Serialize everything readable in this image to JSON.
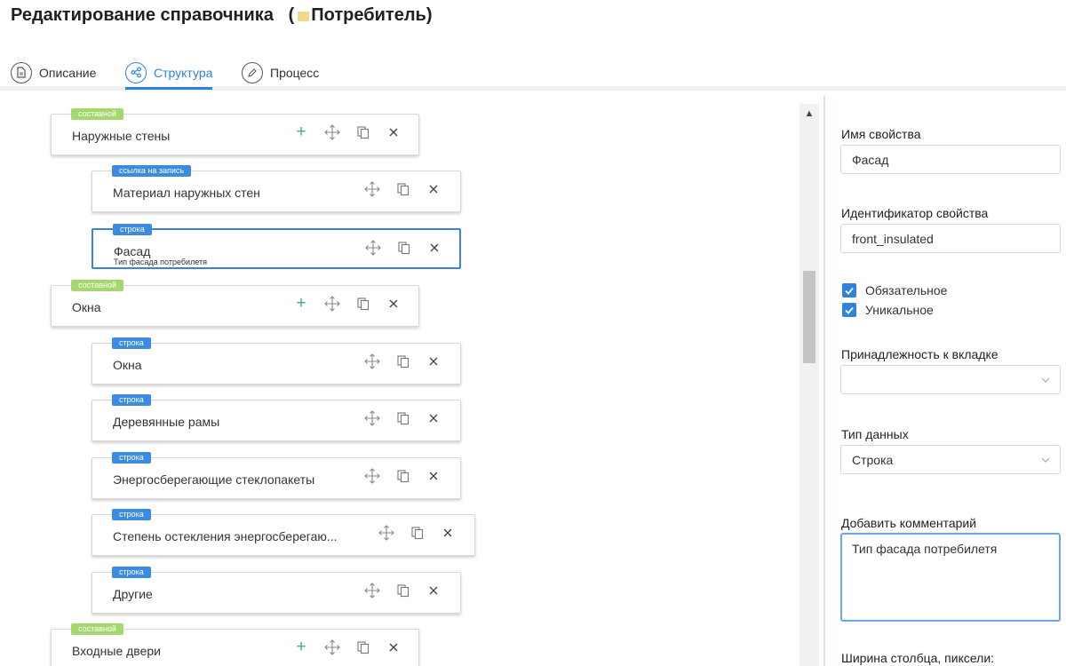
{
  "header": {
    "title_prefix": "Редактирование справочника",
    "title_paren_open": "(",
    "title_name": "Потребитель",
    "title_paren_close": ")"
  },
  "tabs": [
    {
      "label": "Описание",
      "icon": "document-icon",
      "active": false
    },
    {
      "label": "Структура",
      "icon": "share-icon",
      "active": true
    },
    {
      "label": "Процесс",
      "icon": "pencil-icon",
      "active": false
    }
  ],
  "tree": {
    "items": [
      {
        "tag": "составной",
        "tag_color": "#a5d86c",
        "title": "Наружные стены",
        "level": 0
      },
      {
        "tag": "ссылка на запись",
        "tag_color": "#3b8be0",
        "title": "Материал наружных стен",
        "level": 1
      },
      {
        "tag": "строка",
        "tag_color": "#3b8be0",
        "title": "Фасад",
        "subtitle": "Тип фасада потребилетя",
        "level": 1,
        "selected": true
      },
      {
        "tag": "составной",
        "tag_color": "#a5d86c",
        "title": "Окна",
        "level": 0
      },
      {
        "tag": "строка",
        "tag_color": "#3b8be0",
        "title": "Окна",
        "level": 1
      },
      {
        "tag": "строка",
        "tag_color": "#3b8be0",
        "title": "Деревянные рамы",
        "level": 1
      },
      {
        "tag": "строка",
        "tag_color": "#3b8be0",
        "title": "Энергосберегающие стеклопакеты",
        "level": 1
      },
      {
        "tag": "строка",
        "tag_color": "#3b8be0",
        "title": "Степень остекления энергосберегаю...",
        "level": 1
      },
      {
        "tag": "строка",
        "tag_color": "#3b8be0",
        "title": "Другие",
        "level": 1
      },
      {
        "tag": "составной",
        "tag_color": "#a5d86c",
        "title": "Входные двери",
        "level": 0
      }
    ]
  },
  "panel": {
    "property_name_label": "Имя свойства",
    "property_name_value": "Фасад",
    "property_id_label": "Идентификатор свойства",
    "property_id_value": "front_insulated",
    "required_label": "Обязательное",
    "required_checked": true,
    "unique_label": "Уникальное",
    "unique_checked": true,
    "tab_belonging_label": "Принадлежность к вкладке",
    "tab_belonging_value": "",
    "data_type_label": "Тип данных",
    "data_type_value": "Строка",
    "comment_label": "Добавить комментарий",
    "comment_value": "Тип фасада потребилетя",
    "column_width_label": "Ширина столбца, пиксели:"
  },
  "colors": {
    "accent": "#2f82e0",
    "composite_tag": "#a5d86c",
    "type_tag": "#3b8be0",
    "add_icon": "#36b37e"
  }
}
